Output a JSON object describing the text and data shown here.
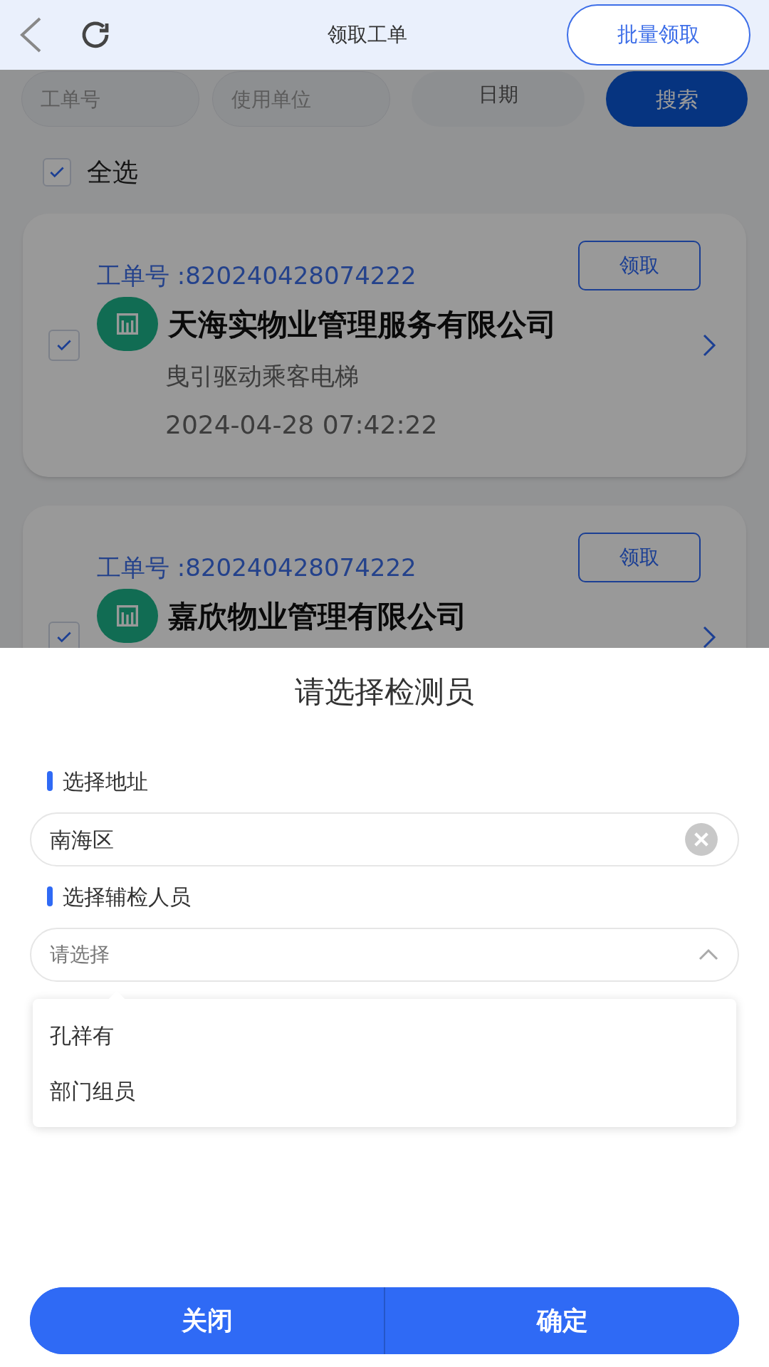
{
  "header": {
    "title": "领取工单",
    "action": "批量领取"
  },
  "filters": [
    {
      "placeholder": "工单号"
    },
    {
      "placeholder": "使用单位"
    }
  ],
  "date_filter": "日期",
  "search_button": "搜索",
  "select_all": {
    "label": "全选",
    "checked": true
  },
  "orders": [
    {
      "order_no": "工单号 :820240428074222",
      "company": "天海实物业管理服务有限公司",
      "type": "曳引驱动乘客电梯",
      "time": "2024-04-28 07:42:22",
      "claim": "领取",
      "checked": true
    },
    {
      "order_no": "工单号 :820240428074222",
      "company": "嘉欣物业管理有限公司",
      "claim": "领取",
      "checked": true
    }
  ],
  "sheet": {
    "title": "请选择检测员",
    "fields": [
      {
        "kind": "input",
        "label": "选择地址",
        "value": "南海区"
      },
      {
        "kind": "select",
        "label": "选择辅检人员",
        "placeholder": "请选择",
        "expanded": true
      }
    ],
    "options": [
      "孔祥有",
      "部门组员"
    ],
    "buttons": [
      "关闭",
      "确定"
    ]
  }
}
